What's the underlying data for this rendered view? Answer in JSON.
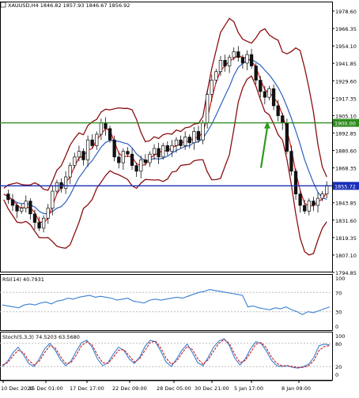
{
  "chart_data": [
    {
      "type": "candlestick",
      "title": "XAUUSD,H4  1846.82 1857.93 1846.67 1856.92",
      "y_ticks": [
        "1978.60",
        "1966.35",
        "1954.10",
        "1941.85",
        "1929.60",
        "1917.35",
        "1905.10",
        "1892.85",
        "1880.60",
        "1868.35",
        "1855.72",
        "1843.85",
        "1831.60",
        "1819.35",
        "1807.10",
        "1794.85"
      ],
      "ylim": [
        1794.85,
        1978.6
      ],
      "x_ticks": [
        "10 Dec 2020",
        "15 Dec 01:00",
        "17 Dec 17:00",
        "22 Dec 09:00",
        "28 Dec 05:00",
        "30 Dec 21:00",
        "5 Jan 17:00",
        "8 Jan 09:00"
      ],
      "levels": [
        {
          "value": 1900.0,
          "label": "1900.00",
          "color": "#2e8b1e"
        },
        {
          "value": 1855.72,
          "label": "1855.72",
          "color": "#1a2fb8"
        }
      ],
      "arrow": {
        "from": 1868.35,
        "to": 1900.0,
        "color": "#2e9a1e"
      },
      "price_path": [
        1850,
        1846,
        1842,
        1838,
        1840,
        1845,
        1836,
        1830,
        1826,
        1833,
        1840,
        1852,
        1858,
        1854,
        1862,
        1870,
        1876,
        1880,
        1874,
        1888,
        1884,
        1892,
        1900,
        1896,
        1888,
        1876,
        1872,
        1880,
        1878,
        1870,
        1866,
        1874,
        1872,
        1878,
        1882,
        1876,
        1884,
        1880,
        1884,
        1888,
        1884,
        1890,
        1886,
        1894,
        1888,
        1900,
        1920,
        1930,
        1936,
        1944,
        1940,
        1946,
        1950,
        1946,
        1942,
        1948,
        1940,
        1930,
        1922,
        1918,
        1924,
        1912,
        1905,
        1900,
        1880,
        1866,
        1850,
        1842,
        1838,
        1845,
        1842,
        1847,
        1850,
        1856
      ]
    },
    {
      "type": "line",
      "title": "RSI(14) 40.7931",
      "y_ticks": [
        "100",
        "70",
        "30",
        "0"
      ],
      "ylim": [
        0,
        100
      ],
      "values": [
        44,
        42,
        40,
        38,
        44,
        46,
        44,
        48,
        50,
        46,
        52,
        54,
        58,
        56,
        60,
        62,
        64,
        60,
        62,
        60,
        58,
        54,
        56,
        58,
        52,
        50,
        48,
        54,
        56,
        54,
        56,
        58,
        60,
        58,
        62,
        66,
        70,
        72,
        76,
        74,
        72,
        70,
        68,
        66,
        64,
        40,
        42,
        38,
        36,
        34,
        38,
        36,
        40,
        34,
        30,
        24,
        30,
        28,
        32,
        36,
        40
      ],
      "color": "#3a7fd5"
    },
    {
      "type": "line",
      "title": "Stoch(5,3,3) 74.5203 63.5680",
      "y_ticks": [
        "100",
        "80",
        "20",
        "0"
      ],
      "ylim": [
        0,
        100
      ],
      "series": [
        {
          "values": [
            20,
            34,
            56,
            70,
            50,
            28,
            20,
            40,
            66,
            80,
            62,
            38,
            22,
            34,
            60,
            82,
            88,
            70,
            40,
            22,
            30,
            52,
            70,
            62,
            40,
            28,
            44,
            72,
            88,
            84,
            60,
            32,
            20,
            40,
            62,
            78,
            56,
            30,
            22,
            44,
            70,
            86,
            92,
            74,
            42,
            24,
            40,
            66,
            84,
            80,
            60,
            36,
            22,
            20,
            22,
            18,
            16,
            20,
            26,
            44,
            74,
            78,
            76
          ],
          "color": "#3a7fd5"
        },
        {
          "values": [
            24,
            30,
            48,
            62,
            56,
            36,
            24,
            34,
            56,
            74,
            68,
            46,
            28,
            30,
            50,
            74,
            84,
            76,
            50,
            30,
            28,
            44,
            62,
            64,
            48,
            32,
            40,
            62,
            82,
            86,
            68,
            42,
            26,
            34,
            54,
            72,
            64,
            40,
            26,
            38,
            60,
            80,
            90,
            80,
            52,
            30,
            36,
            56,
            78,
            82,
            68,
            44,
            28,
            22,
            22,
            20,
            18,
            18,
            22,
            36,
            62,
            72,
            74
          ],
          "color": "#cc1a1a"
        }
      ]
    }
  ]
}
